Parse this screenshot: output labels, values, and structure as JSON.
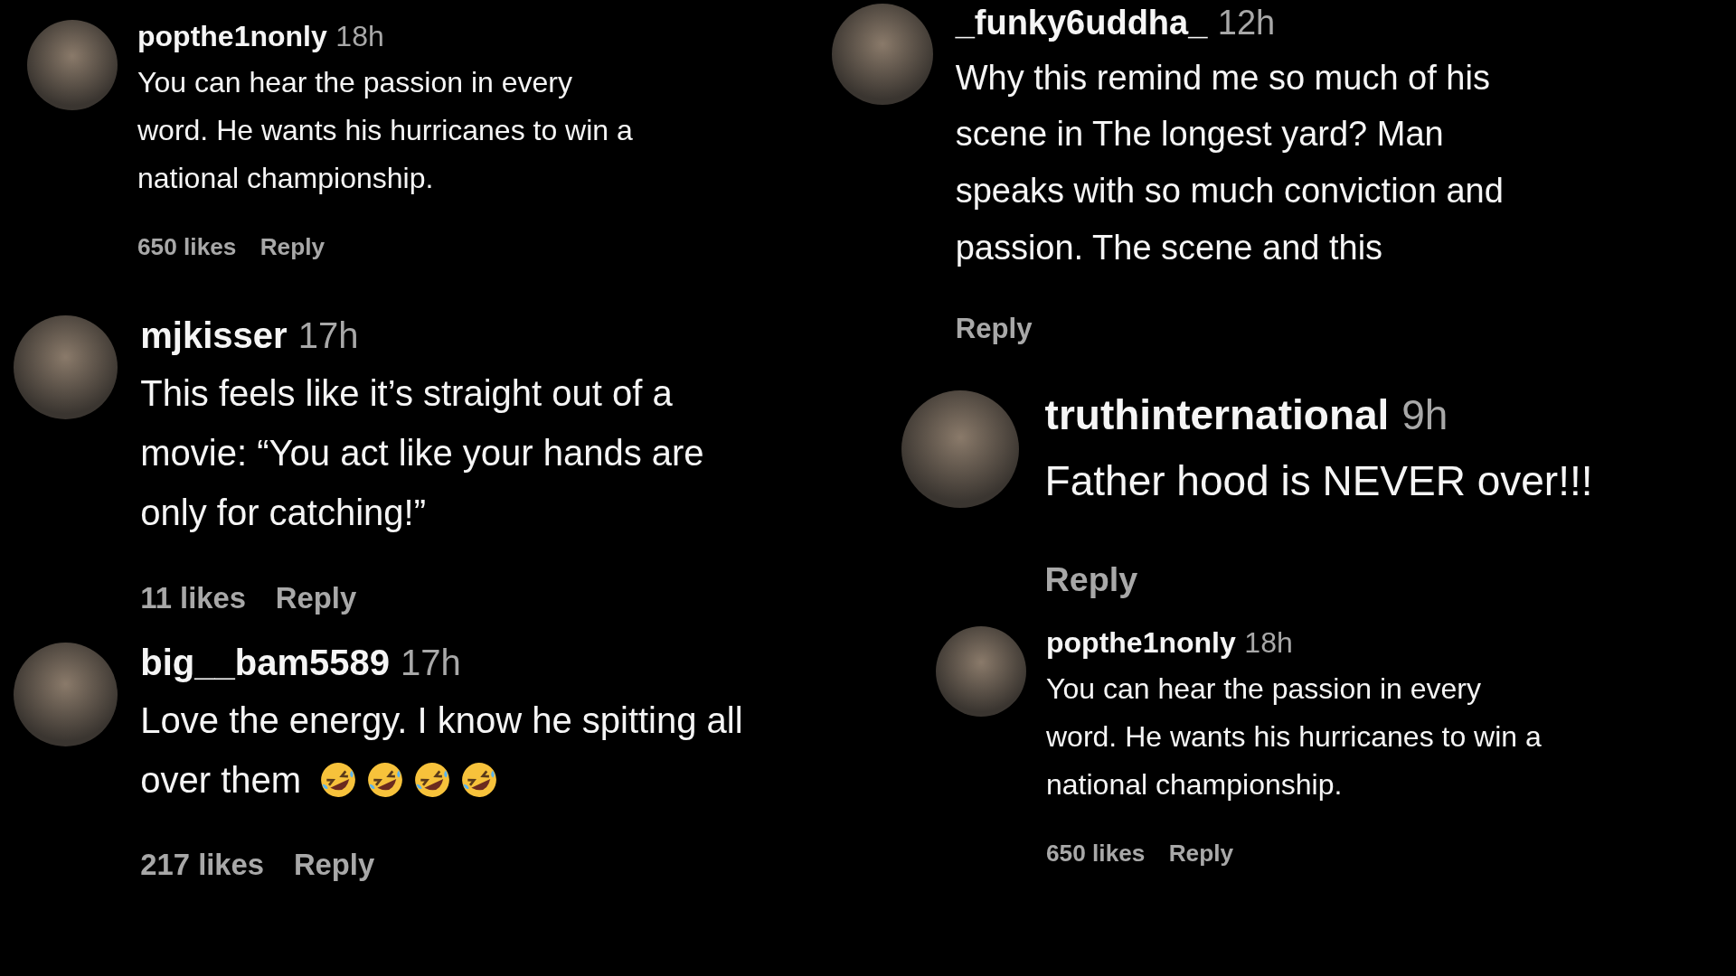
{
  "columns": [
    {
      "comments": [
        {
          "username": "popthe1nonly",
          "time": "18h",
          "text": [
            "You can hear the passion in every",
            "word. He wants his hurricanes to win a",
            "national championship."
          ],
          "likes": "650 likes",
          "reply": "Reply"
        },
        {
          "username": "mjkisser",
          "time": "17h",
          "text": [
            "This feels like it’s straight out of a",
            "movie: “You act like your hands are",
            "only for catching!”"
          ],
          "likes": "11 likes",
          "reply": "Reply"
        },
        {
          "username": "big__bam5589",
          "time": "17h",
          "text": [
            "Love the energy. I know he spitting all",
            "over them"
          ],
          "reactions": [
            {
              "kind": "laughing"
            },
            {
              "kind": "laughing"
            },
            {
              "kind": "laughing"
            },
            {
              "kind": "laughing"
            }
          ],
          "likes": "217 likes",
          "reply": "Reply"
        }
      ]
    },
    {
      "comments": [
        {
          "username": "_funky6uddha_",
          "time": "12h",
          "text": [
            "Why this remind me so much of his",
            "scene in The longest yard? Man",
            "speaks with so much conviction and",
            "passion. The scene and this"
          ],
          "reply": "Reply"
        },
        {
          "username": "truthinternational",
          "time": "9h",
          "text": [
            "Father hood is NEVER over!!!"
          ],
          "reply": "Reply"
        },
        {
          "username": "popthe1nonly",
          "time": "18h",
          "text": [
            "You can hear the passion in every",
            "word. He wants his hurricanes to win a",
            "national championship."
          ],
          "likes": "650 likes",
          "reply": "Reply"
        }
      ]
    }
  ]
}
